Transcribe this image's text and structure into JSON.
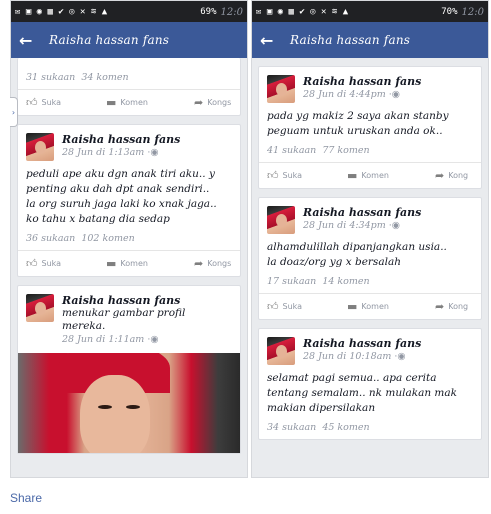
{
  "left": {
    "status": {
      "battery_pct": "69%",
      "time": "12:0"
    },
    "header": {
      "title": "Raisha hassan fans"
    },
    "partial_post": {
      "likes": "31 sukaan",
      "comments": "34 komen"
    },
    "posts": [
      {
        "name": "Raisha hassan fans",
        "time": "28 Jun di 1:13am",
        "lines": [
          "peduli ape aku dgn anak tiri aku.. y",
          "penting aku dah dpt anak sendiri..",
          "la org suruh jaga laki ko xnak jaga..",
          "ko tahu x batang dia sedap"
        ],
        "likes": "36 sukaan",
        "comments": "102 komen"
      },
      {
        "name": "Raisha hassan fans",
        "subtitle": "menukar gambar profil mereka.",
        "time": "28 Jun di 1:11am"
      }
    ],
    "actions": {
      "like": "Suka",
      "comment": "Komen",
      "share": "Kongs"
    }
  },
  "right": {
    "status": {
      "battery_pct": "70%",
      "time": "12:0"
    },
    "header": {
      "title": "Raisha hassan fans"
    },
    "posts": [
      {
        "name": "Raisha hassan fans",
        "time": "28 Jun di 4:44pm",
        "lines": [
          "pada yg makiz 2 saya akan stanby",
          "peguam untuk uruskan anda ok.."
        ],
        "likes": "41 sukaan",
        "comments": "77 komen"
      },
      {
        "name": "Raisha hassan fans",
        "time": "28 Jun di 4:34pm",
        "lines": [
          "alhamdulillah dipanjangkan usia..",
          "la doaz/org yg x bersalah"
        ],
        "likes": "17 sukaan",
        "comments": "14 komen"
      },
      {
        "name": "Raisha hassan fans",
        "time": "28 Jun di 10:18am",
        "lines": [
          "selamat pagi semua.. apa cerita",
          "tentang semalam.. nk mulakan mak",
          "makian dipersilakan"
        ],
        "likes": "34 sukaan",
        "comments": "45 komen"
      }
    ],
    "actions": {
      "like": "Suka",
      "comment": "Komen",
      "share": "Kong"
    }
  },
  "footer": {
    "share": "Share"
  },
  "colors": {
    "fb_blue": "#3b5998",
    "link": "#4b69a8",
    "gray_text": "#9197a3"
  }
}
